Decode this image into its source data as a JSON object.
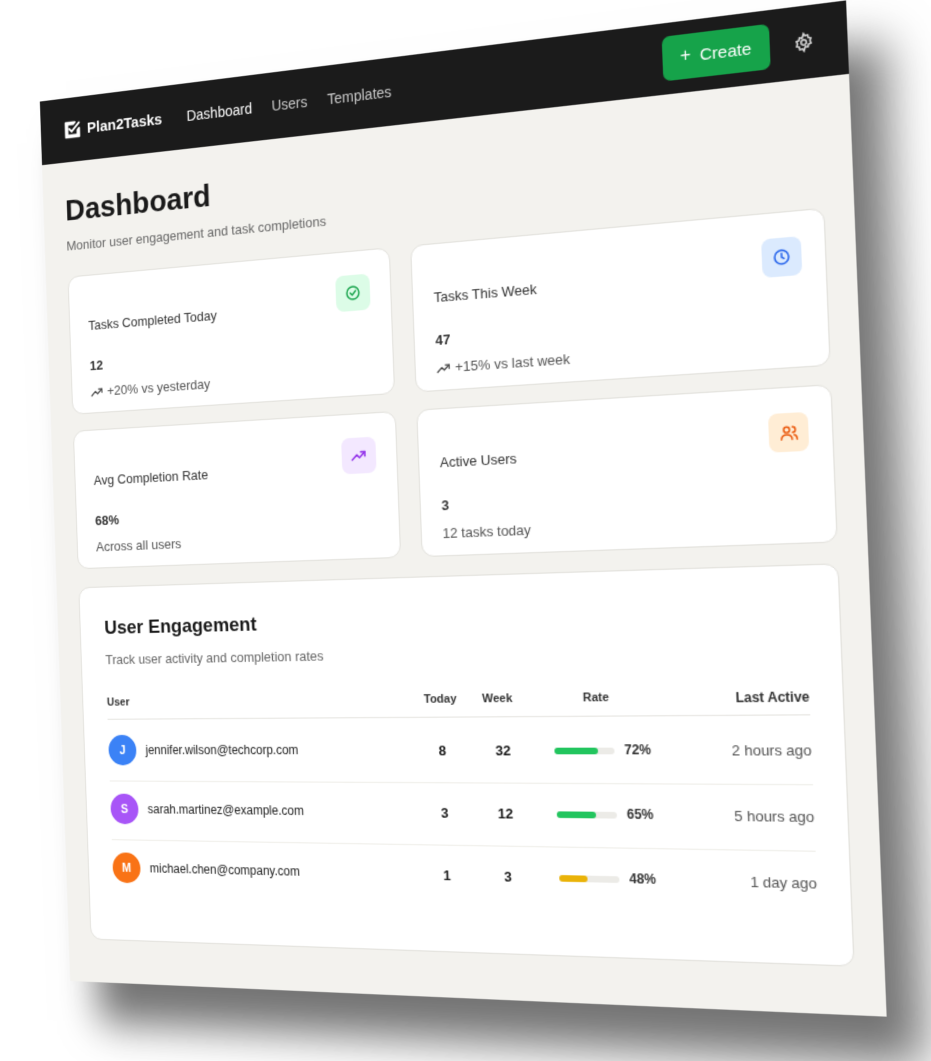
{
  "app": {
    "logo_text": "Plan2Tasks",
    "nav": [
      {
        "label": "Dashboard",
        "active": true
      },
      {
        "label": "Users",
        "active": false
      },
      {
        "label": "Templates",
        "active": false
      }
    ],
    "create_label": "Create",
    "create_icon": "plus-icon",
    "settings_icon": "gear-icon",
    "accent_color": "#16a34a"
  },
  "header": {
    "title": "Dashboard",
    "subtitle": "Monitor user engagement and task completions"
  },
  "stats": [
    {
      "label": "Tasks Completed Today",
      "value": "12",
      "sub": "+20% vs yesterday",
      "trend": true,
      "icon": "check-circle-icon",
      "icon_bg": "#dcfce7",
      "icon_color": "#16a34a"
    },
    {
      "label": "Tasks This Week",
      "value": "47",
      "sub": "+15% vs last week",
      "trend": true,
      "icon": "clock-icon",
      "icon_bg": "#dbeafe",
      "icon_color": "#2563eb"
    },
    {
      "label": "Avg Completion Rate",
      "value": "68%",
      "sub": "Across all users",
      "trend": false,
      "icon": "trending-up-icon",
      "icon_bg": "#f3e8ff",
      "icon_color": "#9333ea"
    },
    {
      "label": "Active Users",
      "value": "3",
      "sub": "12 tasks today",
      "trend": false,
      "icon": "users-icon",
      "icon_bg": "#ffedd5",
      "icon_color": "#ea580c"
    }
  ],
  "engagement": {
    "title": "User Engagement",
    "subtitle": "Track user activity and completion rates",
    "columns": [
      "User",
      "Today",
      "Week",
      "Rate",
      "Last Active"
    ],
    "rows": [
      {
        "initial": "J",
        "avatar_color": "#3b82f6",
        "email": "jennifer.wilson@techcorp.com",
        "today": "8",
        "week": "32",
        "rate": "72%",
        "rate_value": 0.72,
        "bar_color": "#22c55e",
        "last_active": "2 hours ago"
      },
      {
        "initial": "S",
        "avatar_color": "#a855f7",
        "email": "sarah.martinez@example.com",
        "today": "3",
        "week": "12",
        "rate": "65%",
        "rate_value": 0.65,
        "bar_color": "#22c55e",
        "last_active": "5 hours ago"
      },
      {
        "initial": "M",
        "avatar_color": "#f97316",
        "email": "michael.chen@company.com",
        "today": "1",
        "week": "3",
        "rate": "48%",
        "rate_value": 0.48,
        "bar_color": "#eab308",
        "last_active": "1 day ago"
      }
    ]
  }
}
